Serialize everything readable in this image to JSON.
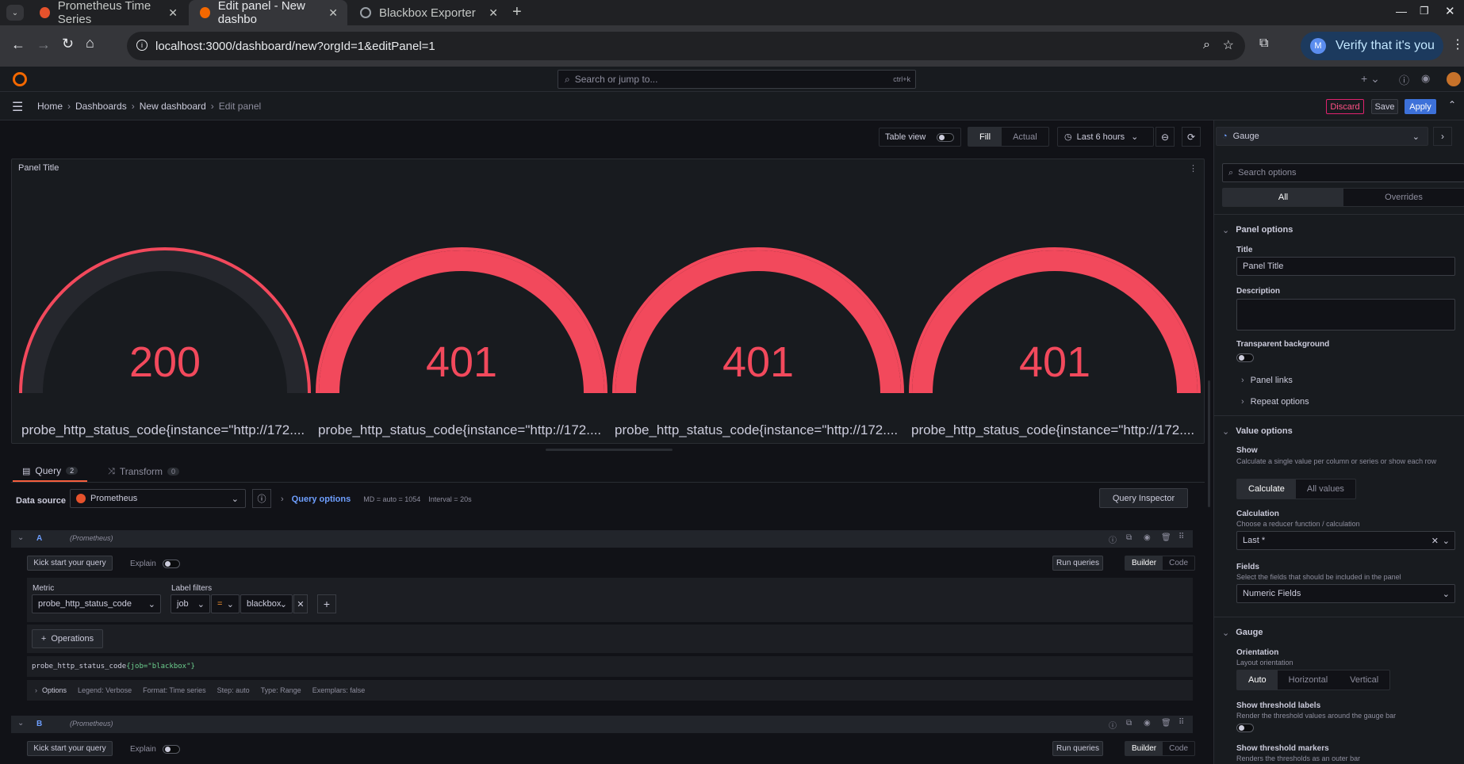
{
  "browser": {
    "tabs": [
      {
        "title": "Prometheus Time Series"
      },
      {
        "title": "Edit panel - New dashbo"
      },
      {
        "title": "Blackbox Exporter"
      }
    ],
    "url": "localhost:3000/dashboard/new?orgId=1&editPanel=1",
    "verify_label": "Verify that it's you",
    "avatar_letter": "M"
  },
  "topbar": {
    "search_placeholder": "Search or jump to...",
    "shortcut": "ctrl+k"
  },
  "breadcrumb": {
    "items": [
      "Home",
      "Dashboards",
      "New dashboard",
      "Edit panel"
    ],
    "sep": "›"
  },
  "actions": {
    "discard": "Discard",
    "save": "Save",
    "apply": "Apply"
  },
  "toolbar": {
    "table_view": "Table view",
    "fill": "Fill",
    "actual": "Actual",
    "time_range": "Last 6 hours"
  },
  "panel": {
    "title": "Panel Title",
    "gauges": [
      {
        "value": "200",
        "label": "probe_http_status_code{instance=\"http://172...."
      },
      {
        "value": "401",
        "label": "probe_http_status_code{instance=\"http://172...."
      },
      {
        "value": "401",
        "label": "probe_http_status_code{instance=\"http://172...."
      },
      {
        "value": "401",
        "label": "probe_http_status_code{instance=\"http://172...."
      }
    ],
    "colors": {
      "red": "#f2495c",
      "track": "#25272d"
    }
  },
  "query_tabs": {
    "query": "Query",
    "query_count": "2",
    "transform": "Transform",
    "transform_count": "0"
  },
  "datasource": {
    "label": "Data source",
    "value": "Prometheus",
    "query_options": "Query options",
    "md": "MD = auto = 1054",
    "interval": "Interval = 20s",
    "inspector": "Query Inspector"
  },
  "queries": [
    {
      "ref": "A",
      "source": "(Prometheus)",
      "kick": "Kick start your query",
      "explain": "Explain",
      "run": "Run queries",
      "builder": "Builder",
      "code": "Code",
      "metric_label": "Metric",
      "metric": "probe_http_status_code",
      "label_filters": "Label filters",
      "filter_key": "job",
      "filter_op": "=",
      "filter_value": "blackbox",
      "operations": "Operations",
      "preview_fn": "probe_http_status_code",
      "preview_args": "{job=\"blackbox\"}",
      "options_label": "Options",
      "opt_legend": "Legend: Verbose",
      "opt_format": "Format: Time series",
      "opt_step": "Step: auto",
      "opt_type": "Type: Range",
      "opt_exemplars": "Exemplars: false"
    },
    {
      "ref": "B",
      "source": "(Prometheus)",
      "kick": "Kick start your query",
      "explain": "Explain",
      "run": "Run queries",
      "builder": "Builder",
      "code": "Code"
    }
  ],
  "options_pane": {
    "viz": "Gauge",
    "search_placeholder": "Search options",
    "tab_all": "All",
    "tab_overrides": "Overrides",
    "panel_options": "Panel options",
    "title_label": "Title",
    "title_value": "Panel Title",
    "description_label": "Description",
    "transparent_label": "Transparent background",
    "panel_links": "Panel links",
    "repeat_options": "Repeat options",
    "value_options": "Value options",
    "show_label": "Show",
    "show_desc": "Calculate a single value per column or series or show each row",
    "show_calc": "Calculate",
    "show_all": "All values",
    "calc_label": "Calculation",
    "calc_desc": "Choose a reducer function / calculation",
    "calc_value": "Last *",
    "fields_label": "Fields",
    "fields_desc": "Select the fields that should be included in the panel",
    "fields_value": "Numeric Fields",
    "gauge_section": "Gauge",
    "orientation_label": "Orientation",
    "orientation_desc": "Layout orientation",
    "orient_auto": "Auto",
    "orient_h": "Horizontal",
    "orient_v": "Vertical",
    "thr_labels": "Show threshold labels",
    "thr_labels_desc": "Render the threshold values around the gauge bar",
    "thr_markers": "Show threshold markers",
    "thr_markers_desc": "Renders the thresholds as an outer bar"
  }
}
